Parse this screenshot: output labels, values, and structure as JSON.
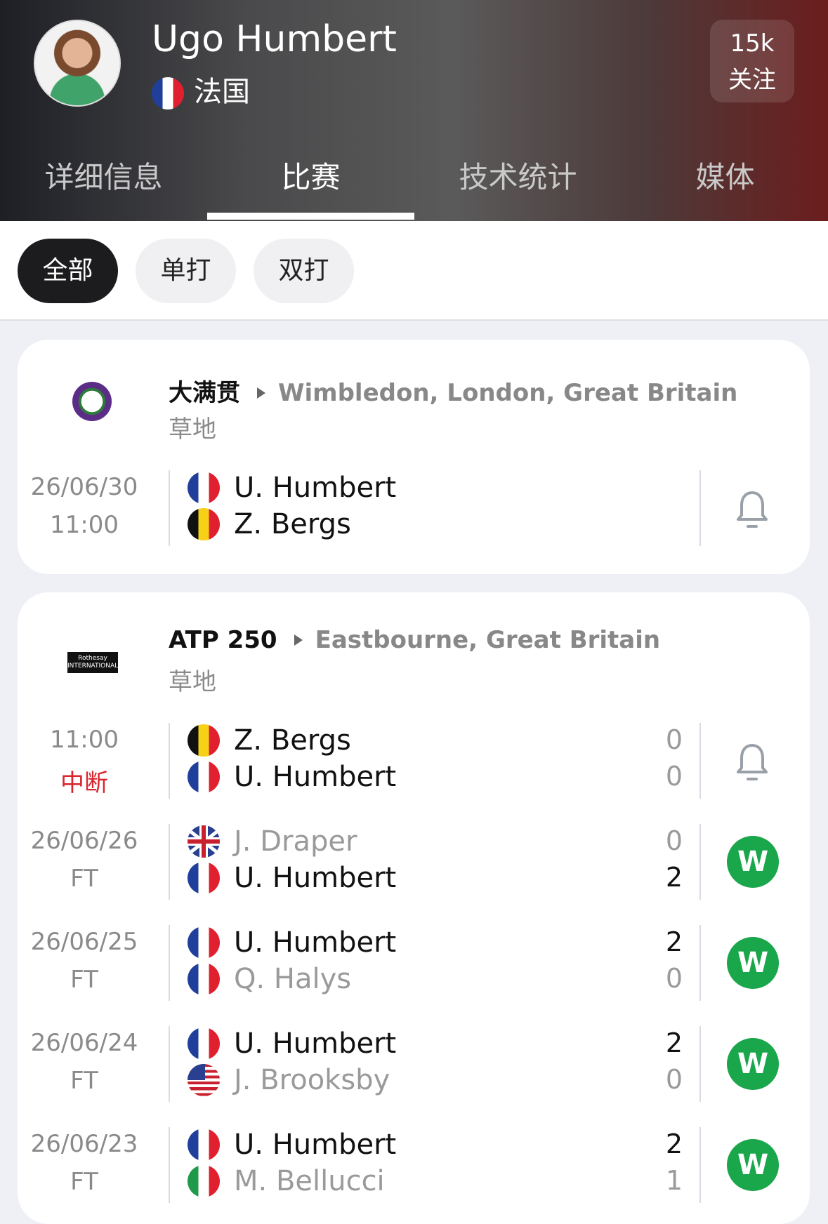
{
  "header": {
    "player_name": "Ugo Humbert",
    "country": "法国",
    "follow_count": "15k",
    "follow_label": "关注"
  },
  "tabs": [
    {
      "label": "详细信息"
    },
    {
      "label": "比赛"
    },
    {
      "label": "技术统计"
    },
    {
      "label": "媒体"
    }
  ],
  "active_tab": "比赛",
  "filters": [
    {
      "label": "全部"
    },
    {
      "label": "单打"
    },
    {
      "label": "双打"
    }
  ],
  "active_filter": "全部",
  "tournaments": [
    {
      "category": "大满贯",
      "location": "Wimbledon, London, Great Britain",
      "surface": "草地",
      "logo_text": "",
      "matches": [
        {
          "date": "26/06/30",
          "status": "11:00",
          "p1": "U. Humbert",
          "p1_flag": "fr",
          "p2": "Z. Bergs",
          "p2_flag": "be",
          "s1": "",
          "s2": "",
          "action": "bell-icon"
        }
      ]
    },
    {
      "category": "ATP 250",
      "location": "Eastbourne, Great Britain",
      "surface": "草地",
      "logo_text": "Rothesay INTERNATIONAL",
      "matches": [
        {
          "date": "11:00",
          "status": "中断",
          "p1": "Z. Bergs",
          "p1_flag": "be",
          "p2": "U. Humbert",
          "p2_flag": "fr",
          "s1": "0",
          "s2": "0",
          "action": "bell-icon"
        },
        {
          "date": "26/06/26",
          "status": "FT",
          "p1": "J. Draper",
          "p1_flag": "gb",
          "p2": "U. Humbert",
          "p2_flag": "fr",
          "s1": "0",
          "s2": "2",
          "action": "W"
        },
        {
          "date": "26/06/25",
          "status": "FT",
          "p1": "U. Humbert",
          "p1_flag": "fr",
          "p2": "Q. Halys",
          "p2_flag": "fr",
          "s1": "2",
          "s2": "0",
          "action": "W"
        },
        {
          "date": "26/06/24",
          "status": "FT",
          "p1": "U. Humbert",
          "p1_flag": "fr",
          "p2": "J. Brooksby",
          "p2_flag": "us",
          "s1": "2",
          "s2": "0",
          "action": "W"
        },
        {
          "date": "26/06/23",
          "status": "FT",
          "p1": "U. Humbert",
          "p1_flag": "fr",
          "p2": "M. Bellucci",
          "p2_flag": "it",
          "s1": "2",
          "s2": "1",
          "action": "W"
        }
      ]
    }
  ],
  "colors": {
    "win_badge": "#1aa64b",
    "interrupted": "#d9252e",
    "active_chip": "#1c1c1e"
  }
}
